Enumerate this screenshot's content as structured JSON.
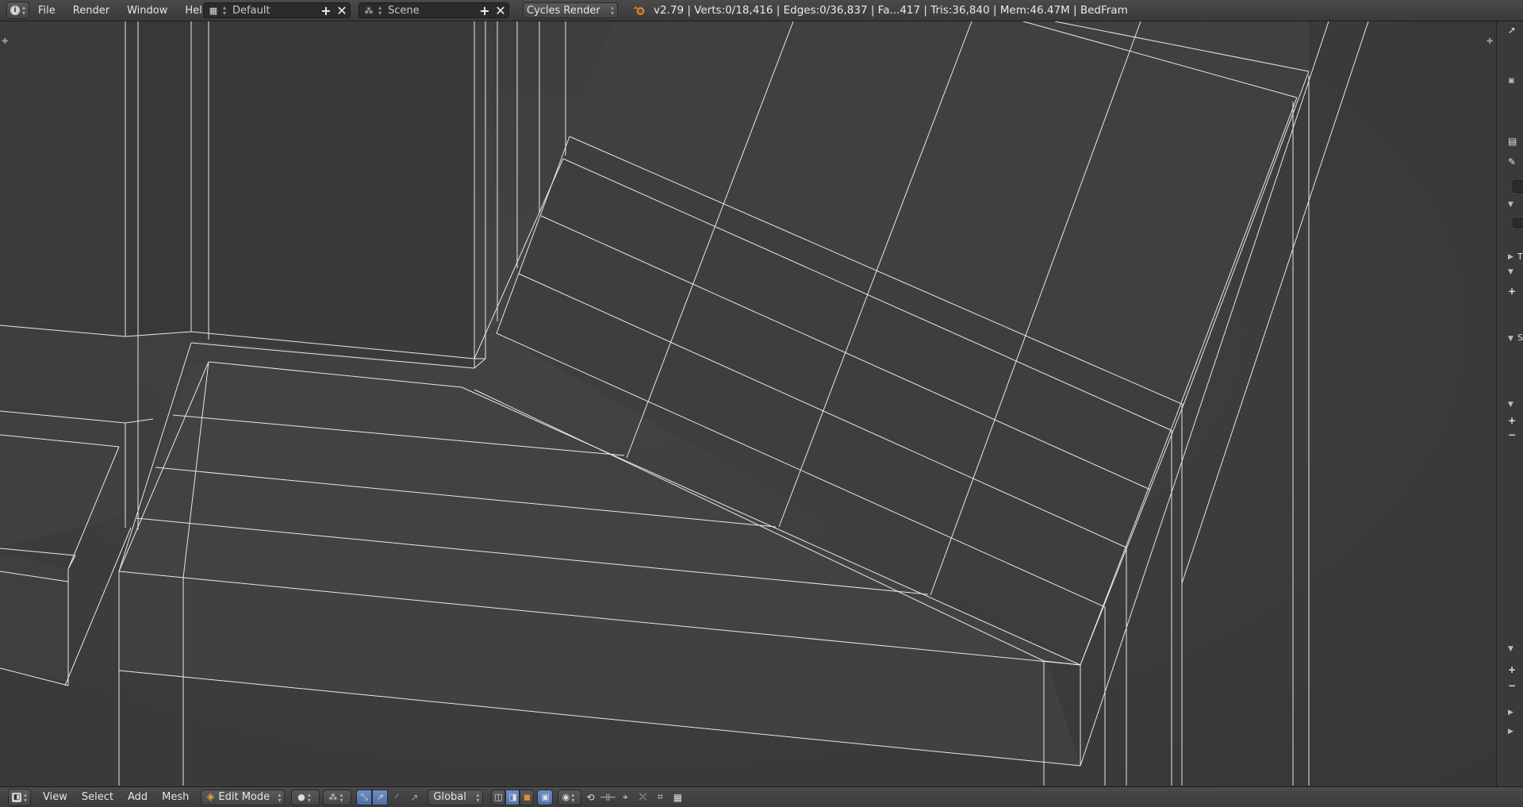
{
  "header": {
    "editor_icon": "info-icon",
    "menus": [
      "File",
      "Render",
      "Window",
      "Help"
    ],
    "layout": {
      "icon": "screen-layout-icon",
      "value": "Default"
    },
    "scene": {
      "icon": "scene-icon",
      "value": "Scene"
    },
    "render_engine": "Cycles Render",
    "stats": "v2.79 | Verts:0/18,416 | Edges:0/36,837 | Fa...417 | Tris:36,840 | Mem:46.47M | BedFram"
  },
  "viewport": {
    "background_color": "#3d3d3d",
    "wire_color": "#e8e8e8"
  },
  "right_panel": {
    "icons": [
      "pointer-icon",
      "camera-icon",
      "pin-icon",
      "chevron-down-icon",
      "triangle-right-icon",
      "plus-icon",
      "minus-icon"
    ],
    "labels": [
      "T",
      "S"
    ]
  },
  "footer": {
    "view_menus": [
      "View",
      "Select",
      "Add",
      "Mesh"
    ],
    "mode": "Edit Mode",
    "orientation": "Global"
  }
}
